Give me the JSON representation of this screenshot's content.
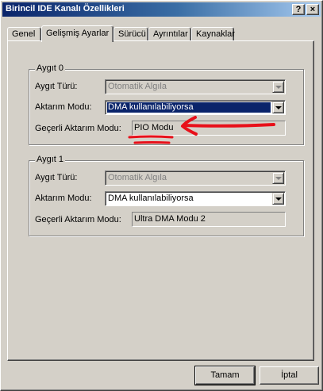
{
  "window": {
    "title": "Birincil IDE Kanalı Özellikleri",
    "help_label": "?",
    "close_label": "×"
  },
  "tabs": [
    {
      "label": "Genel"
    },
    {
      "label": "Gelişmiş Ayarlar",
      "active": true
    },
    {
      "label": "Sürücü"
    },
    {
      "label": "Ayrıntılar"
    },
    {
      "label": "Kaynaklar"
    }
  ],
  "device0": {
    "legend": "Aygıt 0",
    "type_label": "Aygıt Türü:",
    "type_value": "Otomatik Algıla",
    "mode_label": "Aktarım Modu:",
    "mode_value": "DMA kullanılabiliyorsa",
    "current_label": "Geçerli Aktarım Modu:",
    "current_value": "PIO Modu"
  },
  "device1": {
    "legend": "Aygıt 1",
    "type_label": "Aygıt Türü:",
    "type_value": "Otomatik Algıla",
    "mode_label": "Aktarım Modu:",
    "mode_value": "DMA kullanılabiliyorsa",
    "current_label": "Geçerli Aktarım Modu:",
    "current_value": "Ultra DMA Modu 2"
  },
  "buttons": {
    "ok": "Tamam",
    "cancel": "İptal"
  },
  "colors": {
    "face": "#d4d0c8",
    "title_start": "#0a246a",
    "selection": "#0a246a",
    "annotation": "#e8101a"
  }
}
